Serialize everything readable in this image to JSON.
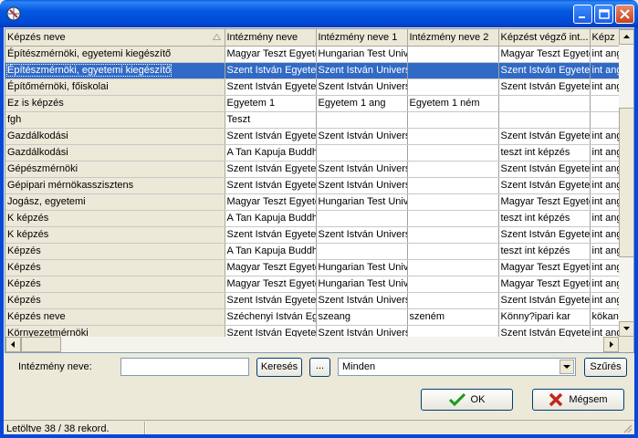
{
  "window": {
    "icon": "app-globe-icon"
  },
  "grid": {
    "columns": [
      "Képzés neve",
      "Intézmény neve",
      "Intézmény neve 1",
      "Intézmény neve 2",
      "Képzést végző int...",
      "Képz"
    ],
    "rows": [
      [
        "Építészmérnöki, egyetemi kiegészítő",
        "Magyar Teszt Egyetem",
        "Hungarian Test University",
        "",
        "Magyar Teszt Egyetem",
        "int ang"
      ],
      [
        "Építészmérnöki, egyetemi kiegészítő",
        "Szent István Egyetem",
        "Szent István University",
        "",
        "Szent István Egyetem",
        "int ang"
      ],
      [
        "Építőmérnöki, főiskolai",
        "Szent István Egyetem",
        "Szent István University",
        "",
        "Szent István Egyetem",
        "int ang"
      ],
      [
        "Ez is képzés",
        "Egyetem 1",
        "Egyetem 1 ang",
        "Egyetem 1 ném",
        "",
        ""
      ],
      [
        "fgh",
        "Teszt",
        "",
        "",
        "",
        ""
      ],
      [
        "Gazdálkodási",
        "Szent István Egyetem",
        "Szent István University",
        "",
        "Szent István Egyetem",
        "int ang"
      ],
      [
        "Gazdálkodási",
        "A Tan Kapuja Buddhista",
        "",
        "",
        "teszt int képzés",
        "int ang"
      ],
      [
        "Gépészmérnöki",
        "Szent István Egyetem",
        "Szent István University",
        "",
        "Szent István Egyetem",
        "int ang"
      ],
      [
        "Gépipari mérnökasszisztens",
        "Szent István Egyetem",
        "Szent István University",
        "",
        "Szent István Egyetem",
        "int ang"
      ],
      [
        "Jogász, egyetemi",
        "Magyar Teszt Egyetem",
        "Hungarian Test University",
        "",
        "Magyar Teszt Egyetem",
        "int ang"
      ],
      [
        "K képzés",
        "A Tan Kapuja Buddhista",
        "",
        "",
        "teszt int képzés",
        "int ang"
      ],
      [
        "K képzés",
        "Szent István Egyetem",
        "Szent István University",
        "",
        "Szent István Egyetem",
        "int ang"
      ],
      [
        "Képzés",
        "A Tan Kapuja Buddhista",
        "",
        "",
        "teszt int képzés",
        "int ang"
      ],
      [
        "Képzés",
        "Magyar Teszt Egyetem",
        "Hungarian Test University",
        "",
        "Magyar Teszt Egyetem",
        "int ang"
      ],
      [
        "Képzés",
        "Magyar Teszt Egyetem",
        "Hungarian Test University",
        "",
        "Magyar Teszt Egyetem",
        "int ang"
      ],
      [
        "Képzés",
        "Szent István Egyetem",
        "Szent István University",
        "",
        "Szent István Egyetem",
        "int ang"
      ],
      [
        "Képzés neve",
        "Széchenyi István Egyetem",
        "szeang",
        "szeném",
        "Könny?ipari kar",
        "kökang"
      ],
      [
        "Környezetmérnöki",
        "Szent István Egyetem",
        "Szent István University",
        "",
        "Szent István Egyetem",
        "int ang"
      ]
    ],
    "selected_row": 1
  },
  "filter": {
    "institution_label": "Intézmény neve:",
    "institution_value": "",
    "search_label": "Keresés",
    "dots_label": "...",
    "combo_value": "Minden",
    "filter_label": "Szűrés"
  },
  "actions": {
    "ok_label": "OK",
    "cancel_label": "Mégsem"
  },
  "status": {
    "text": "Letöltve 38 / 38 rekord."
  }
}
